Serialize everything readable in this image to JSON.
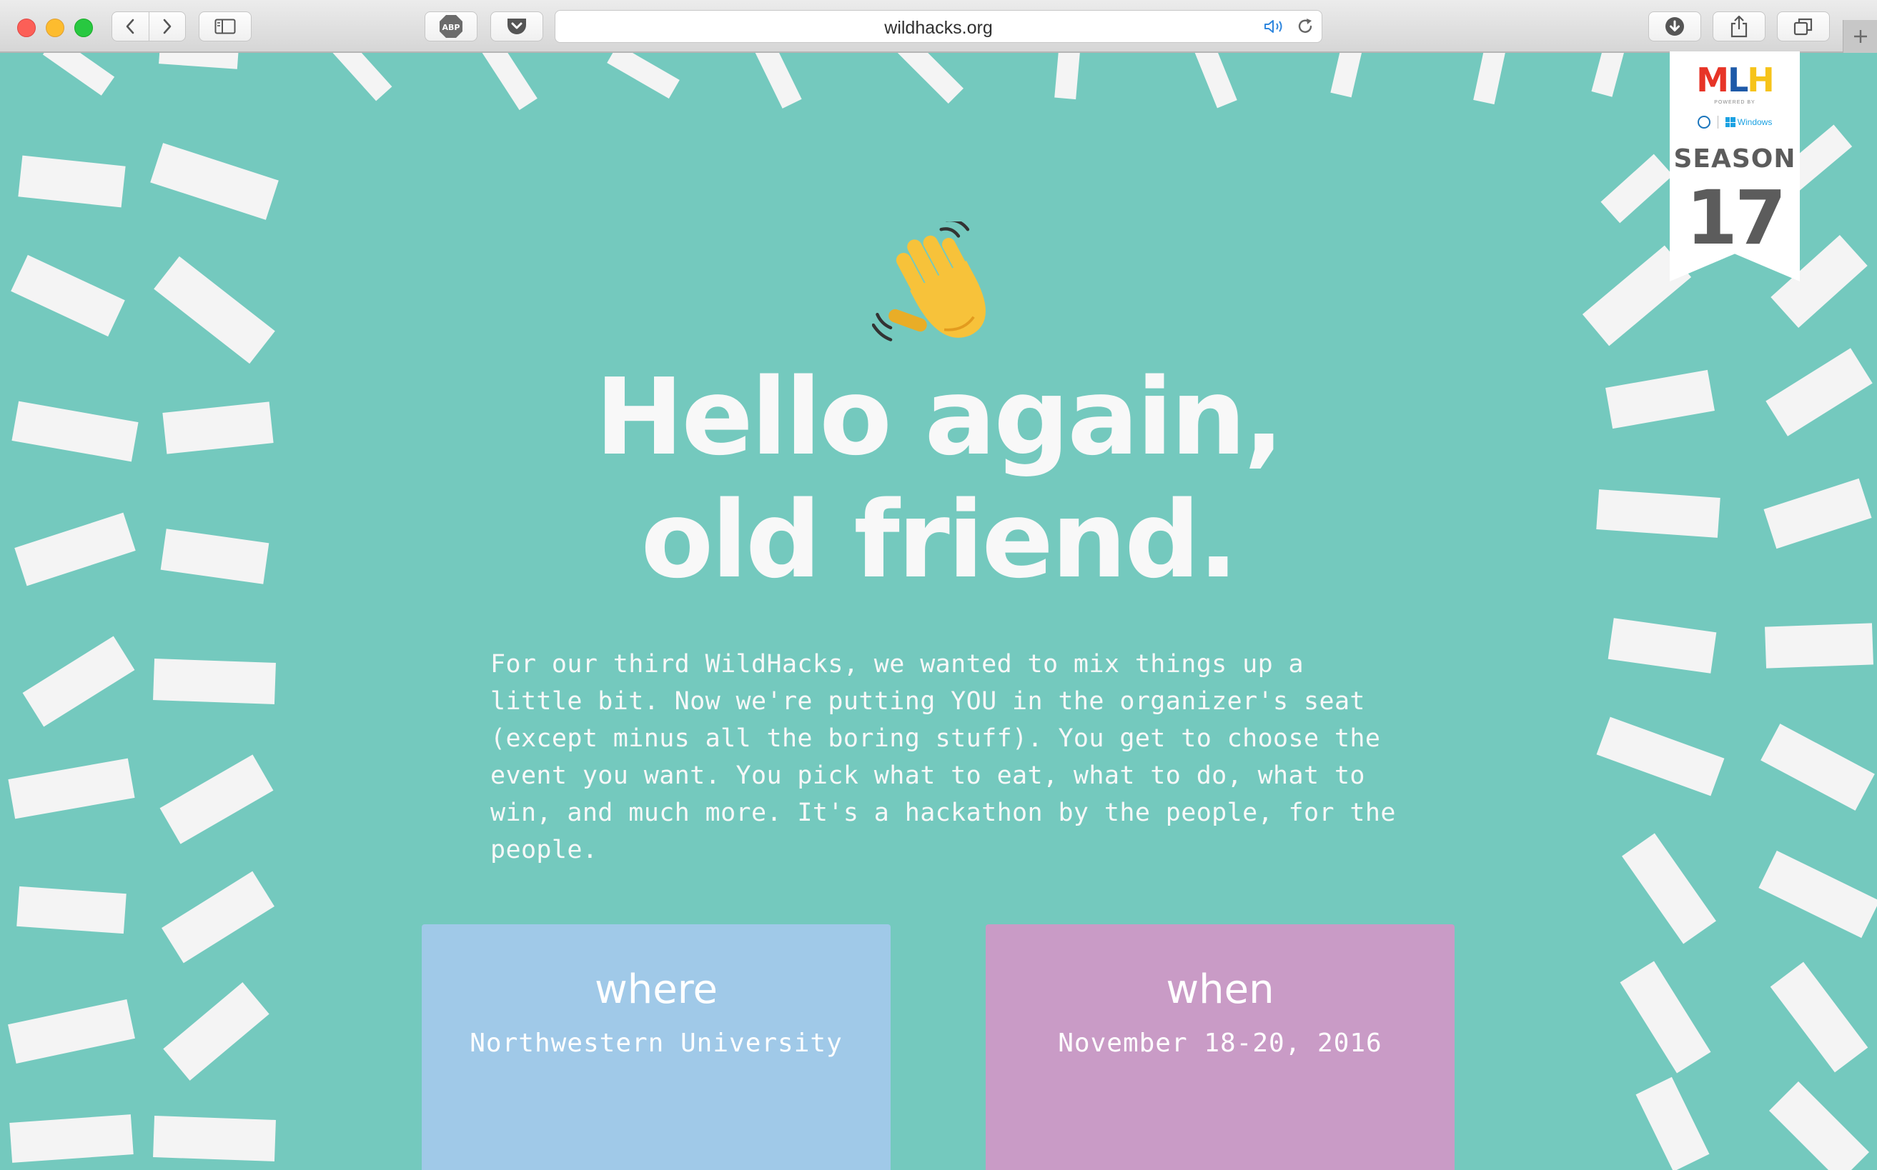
{
  "browser": {
    "url": "wildhacks.org",
    "abp_label": "ABP"
  },
  "hero": {
    "emoji": "waving-hand-icon",
    "headline_line1": "Hello again,",
    "headline_line2": "old friend.",
    "intro": "For our third WildHacks, we wanted to mix things up a little bit. Now we're putting YOU in the organizer's seat (except minus all the boring stuff). You get to choose the event you want. You pick what to eat, what to do, what to win, and much more. It's a hackathon by the people, for the people."
  },
  "cards": {
    "where": {
      "title": "where",
      "value": "Northwestern University",
      "color": "#a0c9e8"
    },
    "when": {
      "title": "when",
      "value": "November 18-20, 2016",
      "color": "#c99bc6"
    }
  },
  "mlh_badge": {
    "logo_m": "M",
    "logo_l": "L",
    "logo_h": "H",
    "powered_by": "POWERED BY",
    "windows": "Windows",
    "season_label": "SEASON",
    "season_number": "17"
  },
  "colors": {
    "background": "#74c9be",
    "confetti": "#f4f4f4"
  }
}
